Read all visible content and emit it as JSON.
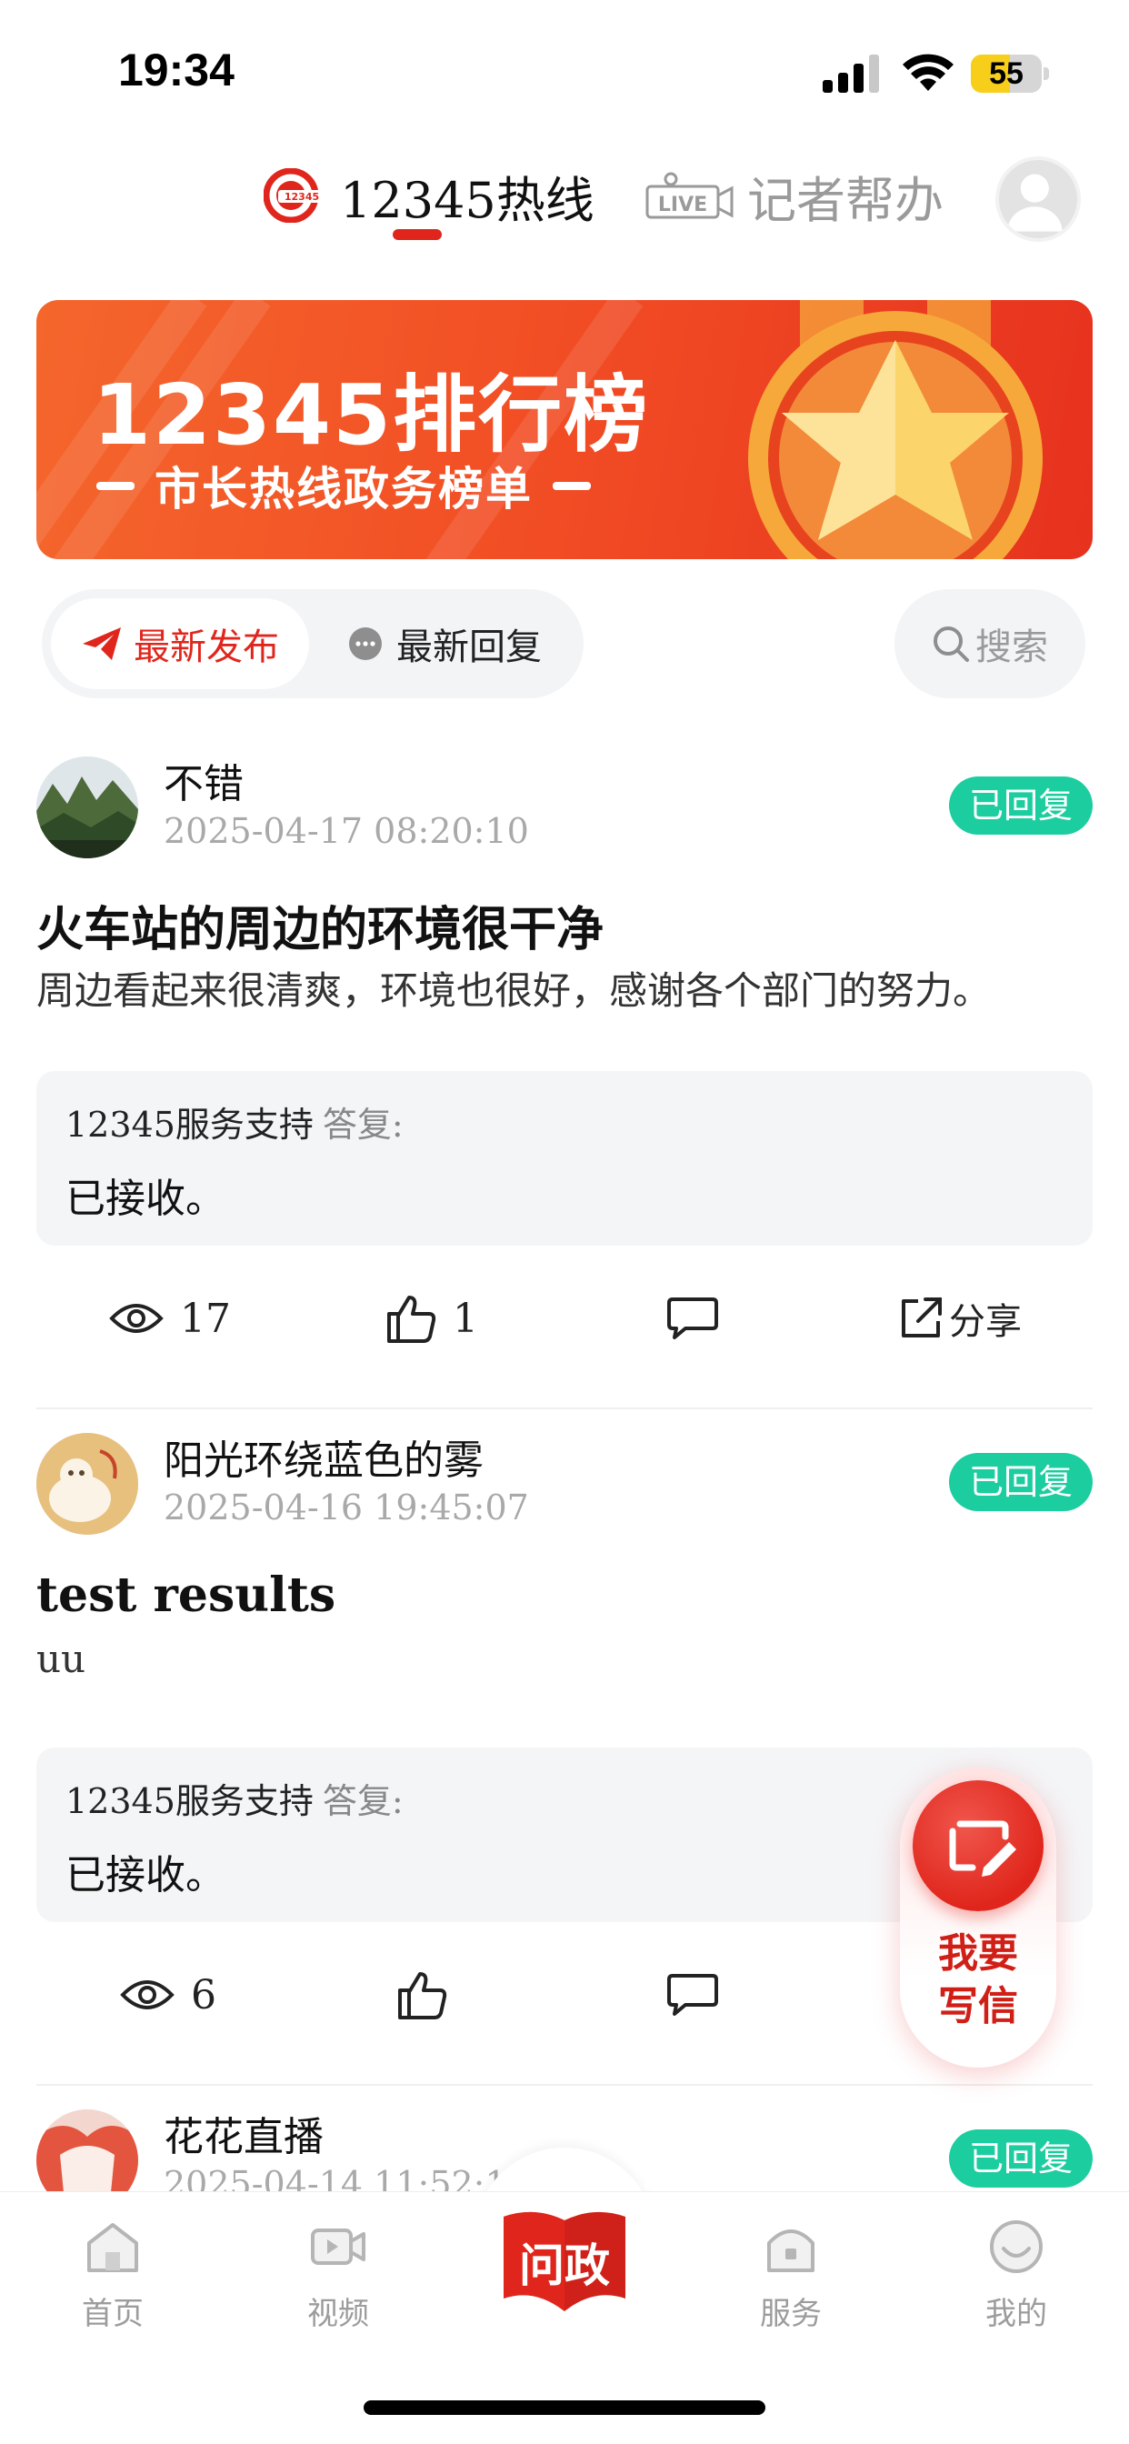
{
  "status_bar": {
    "time": "19:34",
    "battery": "55",
    "battery_level": 0.55
  },
  "top_tabs": {
    "hotline": "12345热线",
    "reporter": "记者帮办",
    "live_logo_text": "LIVE"
  },
  "banner": {
    "title": "12345排行榜",
    "subtitle": "市长热线政务榜单"
  },
  "filters": {
    "latest_post": "最新发布",
    "latest_reply": "最新回复",
    "search": "搜索"
  },
  "posts": [
    {
      "author": "不错",
      "date": "2025-04-17 08:20:10",
      "status": "已回复",
      "title": "火车站的周边的环境很干净",
      "body": "周边看起来很清爽，环境也很好，感谢各个部门的努力。",
      "reply_author": "12345服务支持",
      "reply_suffix": "答复:",
      "reply_text": "已接收。",
      "views": "17",
      "likes": "1",
      "share": "分享"
    },
    {
      "author": "阳光环绕蓝色的雾",
      "date": "2025-04-16 19:45:07",
      "status": "已回复",
      "title": "test results",
      "body": "uu",
      "reply_author": "12345服务支持",
      "reply_suffix": "答复:",
      "reply_text": "已接收。",
      "views": "6",
      "likes": ""
    },
    {
      "author": "花花直播",
      "date": "2025-04-14 11:52:1",
      "status": "已回复"
    }
  ],
  "write_button": {
    "line1": "我要",
    "line2": "写信"
  },
  "bottom_nav": {
    "home": "首页",
    "video": "视频",
    "center": "问政",
    "service": "服务",
    "mine": "我的"
  },
  "colors": {
    "accent": "#e0261c",
    "badge": "#1ccd9f",
    "battery": "#f7cf1a"
  }
}
